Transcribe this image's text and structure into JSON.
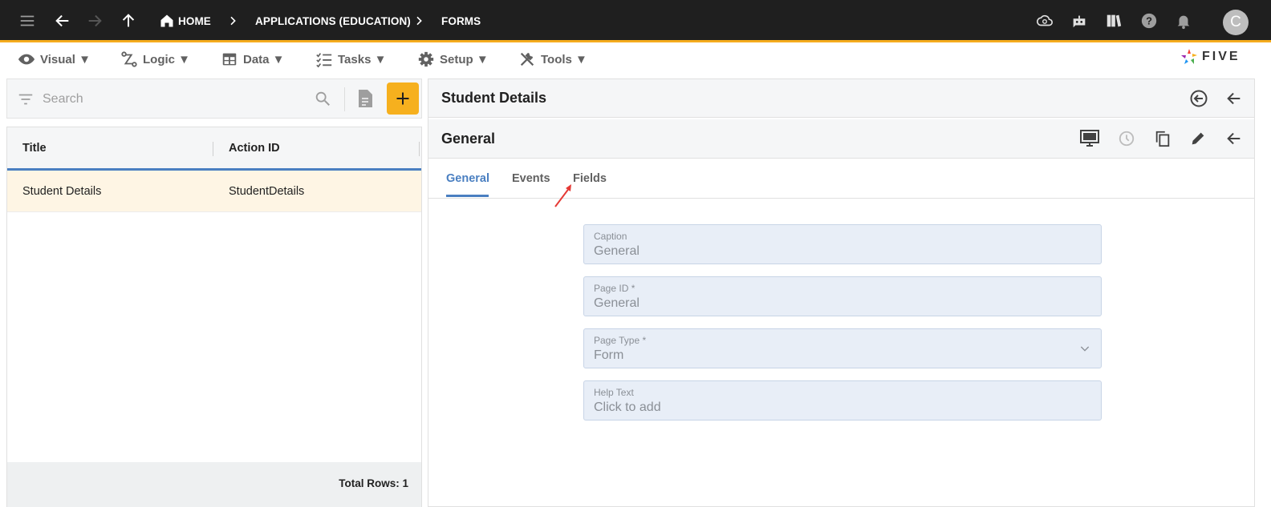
{
  "topbar": {
    "breadcrumbs": [
      "HOME",
      "APPLICATIONS (EDUCATION)",
      "FORMS"
    ],
    "avatar_letter": "C",
    "bar_color": "#1f1f1f",
    "accent_color": "#f5ac1e"
  },
  "menu": {
    "items": [
      {
        "label": "Visual ▼",
        "icon": "eye-icon"
      },
      {
        "label": "Logic ▼",
        "icon": "logic-icon"
      },
      {
        "label": "Data ▼",
        "icon": "table-icon"
      },
      {
        "label": "Tasks ▼",
        "icon": "tasks-icon"
      },
      {
        "label": "Setup ▼",
        "icon": "gear-icon"
      },
      {
        "label": "Tools ▼",
        "icon": "tools-icon"
      }
    ],
    "brand": "FIVE"
  },
  "left_panel": {
    "search_placeholder": "Search",
    "columns": [
      "Title",
      "Action ID"
    ],
    "rows": [
      {
        "title": "Student Details",
        "action_id": "StudentDetails"
      }
    ],
    "footer": "Total Rows: 1"
  },
  "right_panel": {
    "title": "Student Details",
    "section_title": "General",
    "tabs": [
      "General",
      "Events",
      "Fields"
    ],
    "active_tab": "General",
    "fields": [
      {
        "label": "Caption",
        "value": "General"
      },
      {
        "label": "Page ID *",
        "value": "General"
      },
      {
        "label": "Page Type *",
        "value": "Form"
      },
      {
        "label": "Help Text",
        "value": "Click to add"
      }
    ]
  },
  "colors": {
    "tab_active": "#4a7fc1",
    "add_button": "#f6b01e",
    "field_bg": "#e8eef7",
    "selected_row": "#fef5e4"
  }
}
